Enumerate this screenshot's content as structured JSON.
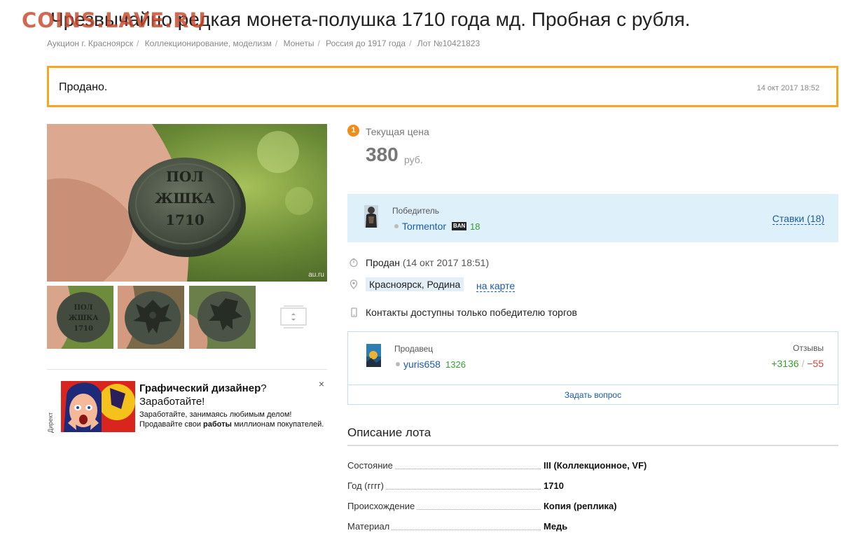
{
  "watermark": "COINS.LAVE.RU",
  "title": "Чрезвычайно редкая монета-полушка 1710 года мд. Пробная с рубля.",
  "breadcrumb": [
    "Аукцион г. Красноярск",
    "Коллекционирование, моделизм",
    "Монеты",
    "Россия до 1917 года",
    "Лот №10421823"
  ],
  "status": {
    "label": "Продано.",
    "date": "14 окт 2017 18:52"
  },
  "photo": {
    "coin_text": [
      "ПОЛ",
      "ЖШКА",
      "1710"
    ],
    "watermark": "au.ru"
  },
  "price": {
    "badge": "1",
    "label": "Текущая цена",
    "value": "380",
    "currency": "руб."
  },
  "winner": {
    "label": "Победитель",
    "name": "Tormentor",
    "badge": "BAN",
    "count": "18",
    "bids": "Ставки (18)"
  },
  "sold": {
    "label": "Продан",
    "date": "(14 окт 2017 18:51)"
  },
  "location": {
    "city": "Красноярск, Родина",
    "map": "на карте"
  },
  "contacts": "Контакты доступны только победителю торгов",
  "seller": {
    "label": "Продавец",
    "name": "yuris658",
    "count": "1326",
    "reviews_label": "Отзывы",
    "positive": "+3136",
    "sep": "/",
    "negative": "−55",
    "ask": "Задать вопрос"
  },
  "ad": {
    "tag": "Директ",
    "headline": "Графический дизайнер",
    "headline_q": "?",
    "headline2": "Заработайте!",
    "line1": "Заработайте, занимаясь любимым делом!",
    "line2_a": "Продавайте свои ",
    "line2_b": "работы",
    "line2_c": " миллионам покупателей.",
    "close": "×"
  },
  "description": {
    "title": "Описание лота",
    "specs": [
      {
        "key": "Состояние",
        "value": "III (Коллекционное, VF)"
      },
      {
        "key": "Год (гггг)",
        "value": "1710"
      },
      {
        "key": "Происхождение",
        "value": "Копия (реплика)"
      },
      {
        "key": "Материал",
        "value": "Медь"
      }
    ]
  },
  "icons": {
    "clock": "clock-icon",
    "pin": "location-pin-icon",
    "phone": "phone-icon"
  },
  "colors": {
    "accent": "#f5a623",
    "link": "#1a5aa8",
    "positive": "#3a9a30",
    "negative": "#d0453b",
    "winner_bg": "#def1fb"
  }
}
